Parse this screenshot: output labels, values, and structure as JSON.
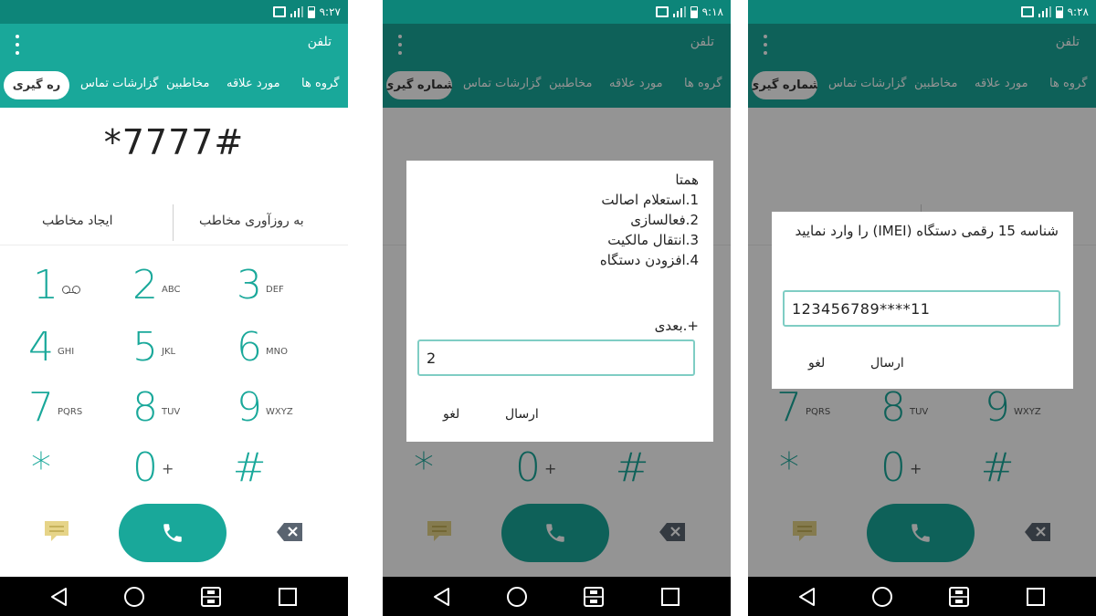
{
  "status": {
    "time_1": "۹:۲۷",
    "time_2": "۹:۱۸",
    "time_3": "۹:۲۸"
  },
  "app": {
    "title": "تلفن"
  },
  "tabs": {
    "groups": "گروه ها",
    "favorites": "مورد علاقه",
    "contacts": "مخاطبین",
    "call_logs": "گزارشات تماس",
    "dialer": "شماره گیری",
    "dialer_truncated": "ره گیری"
  },
  "dialer": {
    "number": "*7777#",
    "create_contact": "ایجاد مخاطب",
    "update_contact": "به روزآوری مخاطب",
    "keys": [
      {
        "digit": "1",
        "letters": ""
      },
      {
        "digit": "2",
        "letters": "ABC"
      },
      {
        "digit": "3",
        "letters": "DEF"
      },
      {
        "digit": "4",
        "letters": "GHI"
      },
      {
        "digit": "5",
        "letters": "JKL"
      },
      {
        "digit": "6",
        "letters": "MNO"
      },
      {
        "digit": "7",
        "letters": "PQRS"
      },
      {
        "digit": "8",
        "letters": "TUV"
      },
      {
        "digit": "9",
        "letters": "WXYZ"
      },
      {
        "digit": "*",
        "letters": ""
      },
      {
        "digit": "0",
        "letters": "+"
      },
      {
        "digit": "#",
        "letters": ""
      }
    ]
  },
  "dialog_menu": {
    "text": "همتا\n1.استعلام اصالت\n2.فعالسازی\n3.انتقال مالکیت\n4.افزودن دستگاه",
    "next": "+.بعدی",
    "input_value": "2",
    "send": "ارسال",
    "cancel": "لغو"
  },
  "dialog_imei": {
    "text": "شناسه 15 رقمی دستگاه (IMEI) را وارد نمایید",
    "input_value": "123456789****11",
    "send": "ارسال",
    "cancel": "لغو"
  },
  "colors": {
    "accent": "#19a89a",
    "status_bar": "#0d8579",
    "input_border": "#7fcdc4"
  },
  "icons": [
    "voicemail-icon",
    "message-icon",
    "phone-icon",
    "backspace-icon",
    "back-icon",
    "home-icon",
    "dual-sim-icon",
    "recents-icon",
    "menu-icon"
  ]
}
